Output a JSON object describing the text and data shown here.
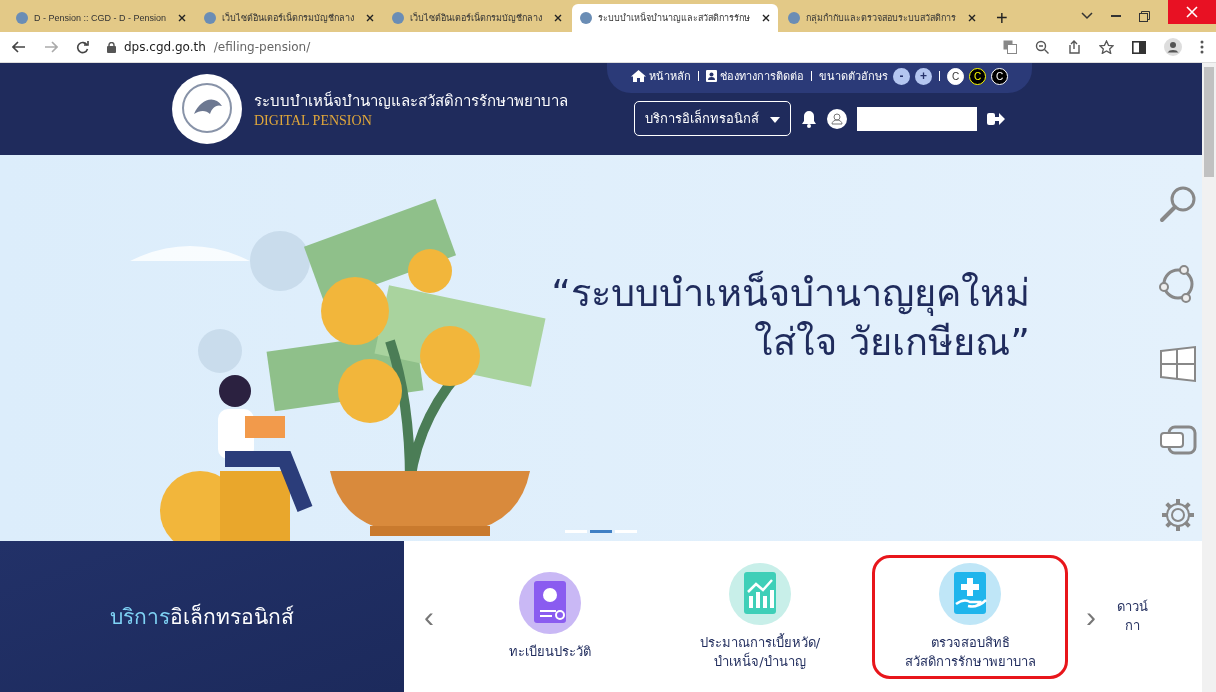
{
  "browser": {
    "tabs": [
      {
        "title": "D - Pension :: CGD - D - Pension",
        "selected": false
      },
      {
        "title": "เว็บไซต์อินเตอร์เน็ตกรมบัญชีกลาง",
        "selected": false
      },
      {
        "title": "เว็บไซต์อินเตอร์เน็ตกรมบัญชีกลาง",
        "selected": false
      },
      {
        "title": "ระบบบำเหน็จบำนาญและสวัสดิการรักษ",
        "selected": true
      },
      {
        "title": "กลุ่มกำกับและตรวจสอบระบบสวัสดิการ",
        "selected": false
      }
    ],
    "new_tab": "+",
    "url_host": "dps.cgd.go.th",
    "url_path": "/efiling-pension/"
  },
  "header": {
    "title": "ระบบบำเหน็จบำนาญและสวัสดิการรักษาพยาบาล",
    "subtitle": "DIGITAL PENSION",
    "top_links": [
      {
        "label": "หน้าหลัก",
        "kind": "home"
      },
      {
        "label": "ช่องทางการติดต่อ",
        "kind": "contact"
      }
    ],
    "font_size_label": "ขนาดตัวอักษร",
    "font_buttons": [
      "-",
      "+"
    ],
    "contrast_buttons": [
      "C",
      "C",
      "C"
    ],
    "menu": "บริการอิเล็กทรอนิกส์"
  },
  "hero": {
    "lines": [
      "“ระบบบำเหน็จบำนาญยุคใหม่",
      "ใส่ใจ วัยเกษียณ”"
    ],
    "slides": [
      {
        "selected": false
      },
      {
        "selected": true
      },
      {
        "selected": false
      }
    ]
  },
  "services": {
    "title_accent": "บริการ",
    "title_rest": "อิเล็กทรอนิกส์",
    "prev": "‹",
    "next": "›",
    "items": [
      {
        "lines": [
          "ทะเบียนประวัติ"
        ],
        "kind": "profile",
        "highlighted": false
      },
      {
        "lines": [
          "ประมาณการเบี้ยหวัด/",
          "บำเหน็จ/บำนาญ"
        ],
        "kind": "chart",
        "highlighted": false
      },
      {
        "lines": [
          "ตรวจสอบสิทธิ",
          "สวัสดิการรักษาพยาบาล"
        ],
        "kind": "medical",
        "highlighted": true
      },
      {
        "lines": [
          "ดาวน์",
          "กา"
        ],
        "kind": "partial",
        "highlighted": false
      }
    ]
  }
}
